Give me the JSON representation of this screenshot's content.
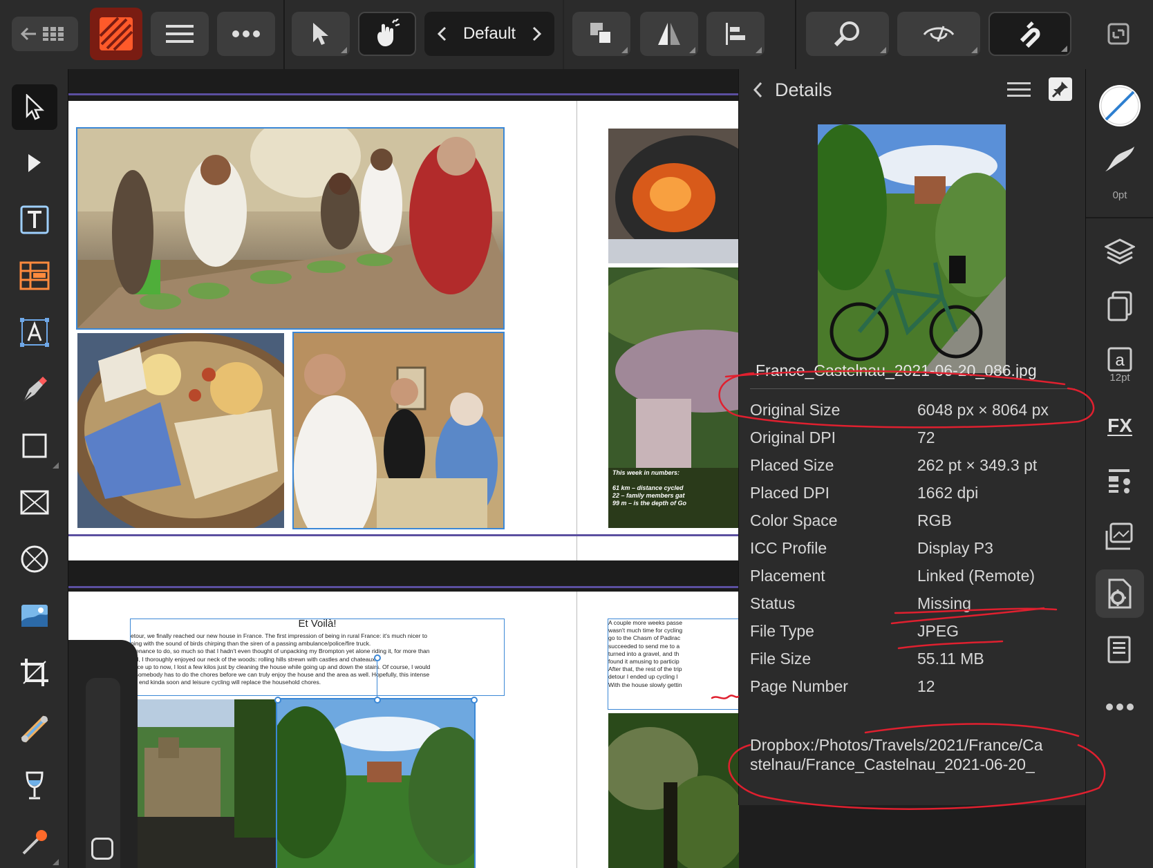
{
  "toolbar": {
    "preset_label": "Default",
    "icons": [
      "back-to-documents-icon",
      "app-logo",
      "hamburger-menu-icon",
      "more-icon",
      "move-tool-icon",
      "gesture-icon",
      "previous-preset-icon",
      "next-preset-icon",
      "arrange-icon",
      "flip-icon",
      "align-icon",
      "zoom-icon",
      "view-mode-icon",
      "snapping-icon",
      "fullscreen-icon"
    ]
  },
  "left_tools": [
    "move-tool",
    "node-tool",
    "frame-text-tool",
    "table-tool",
    "artistic-text-tool",
    "pen-tool",
    "rectangle-tool",
    "picture-frame-tool",
    "ellipse-frame-tool",
    "place-image-tool",
    "crop-tool",
    "fill-tool",
    "transparency-tool",
    "color-picker-tool"
  ],
  "document": {
    "spread2_heading": "Et Voilà!",
    "left_body_lines": [
      "etour, we finally reached our new house in France. The first impression of being in rural France: it's much nicer to",
      "ning with the sound of birds chirping than the siren of a passing ambulance/police/fire truck.",
      "ntenance to do, so much so that I hadn't even thought of unpacking my Brompton yet alone riding it, for more than",
      "did, I thoroughly enjoyed our neck of the woods: rolling hills strewn with castles and chateaux.",
      "once up to now, I lost a few kilos just by cleaning the house while going up and down the stairs. Of course, I would",
      "s somebody has to do the chores before we can truly enjoy the house and the area as well. Hopefully, this intense",
      "an end kinda soon and leisure cycling will replace the household chores."
    ],
    "right_body_lines": [
      "A couple more weeks passe",
      "wasn't much time for cycling",
      "go to the Chasm of Padirac",
      "succeeded to send me to a",
      "turned into a gravel, and th",
      "found it amusing to particip",
      "After that, the rest of the trip",
      "detour I ended up cycling l",
      "With the house slowly gettin"
    ],
    "numbers_title": "This week in numbers:",
    "numbers_lines": [
      "61 km – distance cycled",
      "22 – family members gat",
      "99 m – is the depth of Go"
    ]
  },
  "details": {
    "header": "Details",
    "filename": "France_Castelnau_2021-06-20_086.jpg",
    "rows": [
      {
        "key": "Original Size",
        "value": "6048 px × 8064 px"
      },
      {
        "key": "Original DPI",
        "value": "72"
      },
      {
        "key": "Placed Size",
        "value": "262 pt × 349.3 pt"
      },
      {
        "key": "Placed DPI",
        "value": "1662 dpi"
      },
      {
        "key": "Color Space",
        "value": "RGB"
      },
      {
        "key": "ICC Profile",
        "value": "Display P3"
      },
      {
        "key": "Placement",
        "value": "Linked (Remote)"
      },
      {
        "key": "Status",
        "value": "Missing"
      },
      {
        "key": "File Type",
        "value": "JPEG"
      },
      {
        "key": "File Size",
        "value": "55.11 MB"
      },
      {
        "key": "Page Number",
        "value": "12"
      }
    ],
    "path_line1": "Dropbox:/Photos/Travels/2021/France/Ca",
    "path_line2": "stelnau/France_Castelnau_2021-06-20_"
  },
  "studio": {
    "stroke_width_label": "0pt",
    "text_size_label": "12pt",
    "icons": [
      "stroke-color-icon",
      "brush-icon",
      "layers-icon",
      "pages-icon",
      "character-icon",
      "fx-icon",
      "text-styles-icon",
      "resource-manager-icon",
      "document-settings-icon",
      "preflight-icon",
      "more-icon"
    ]
  },
  "colors": {
    "accent": "#3a87d6",
    "logo_orange": "#ff5a2a",
    "annotation_red": "#e0202f",
    "panel_bg": "#2b2b2b",
    "toolbar_bg": "#2b2b2b",
    "canvas_bg": "#1c1c1c"
  }
}
